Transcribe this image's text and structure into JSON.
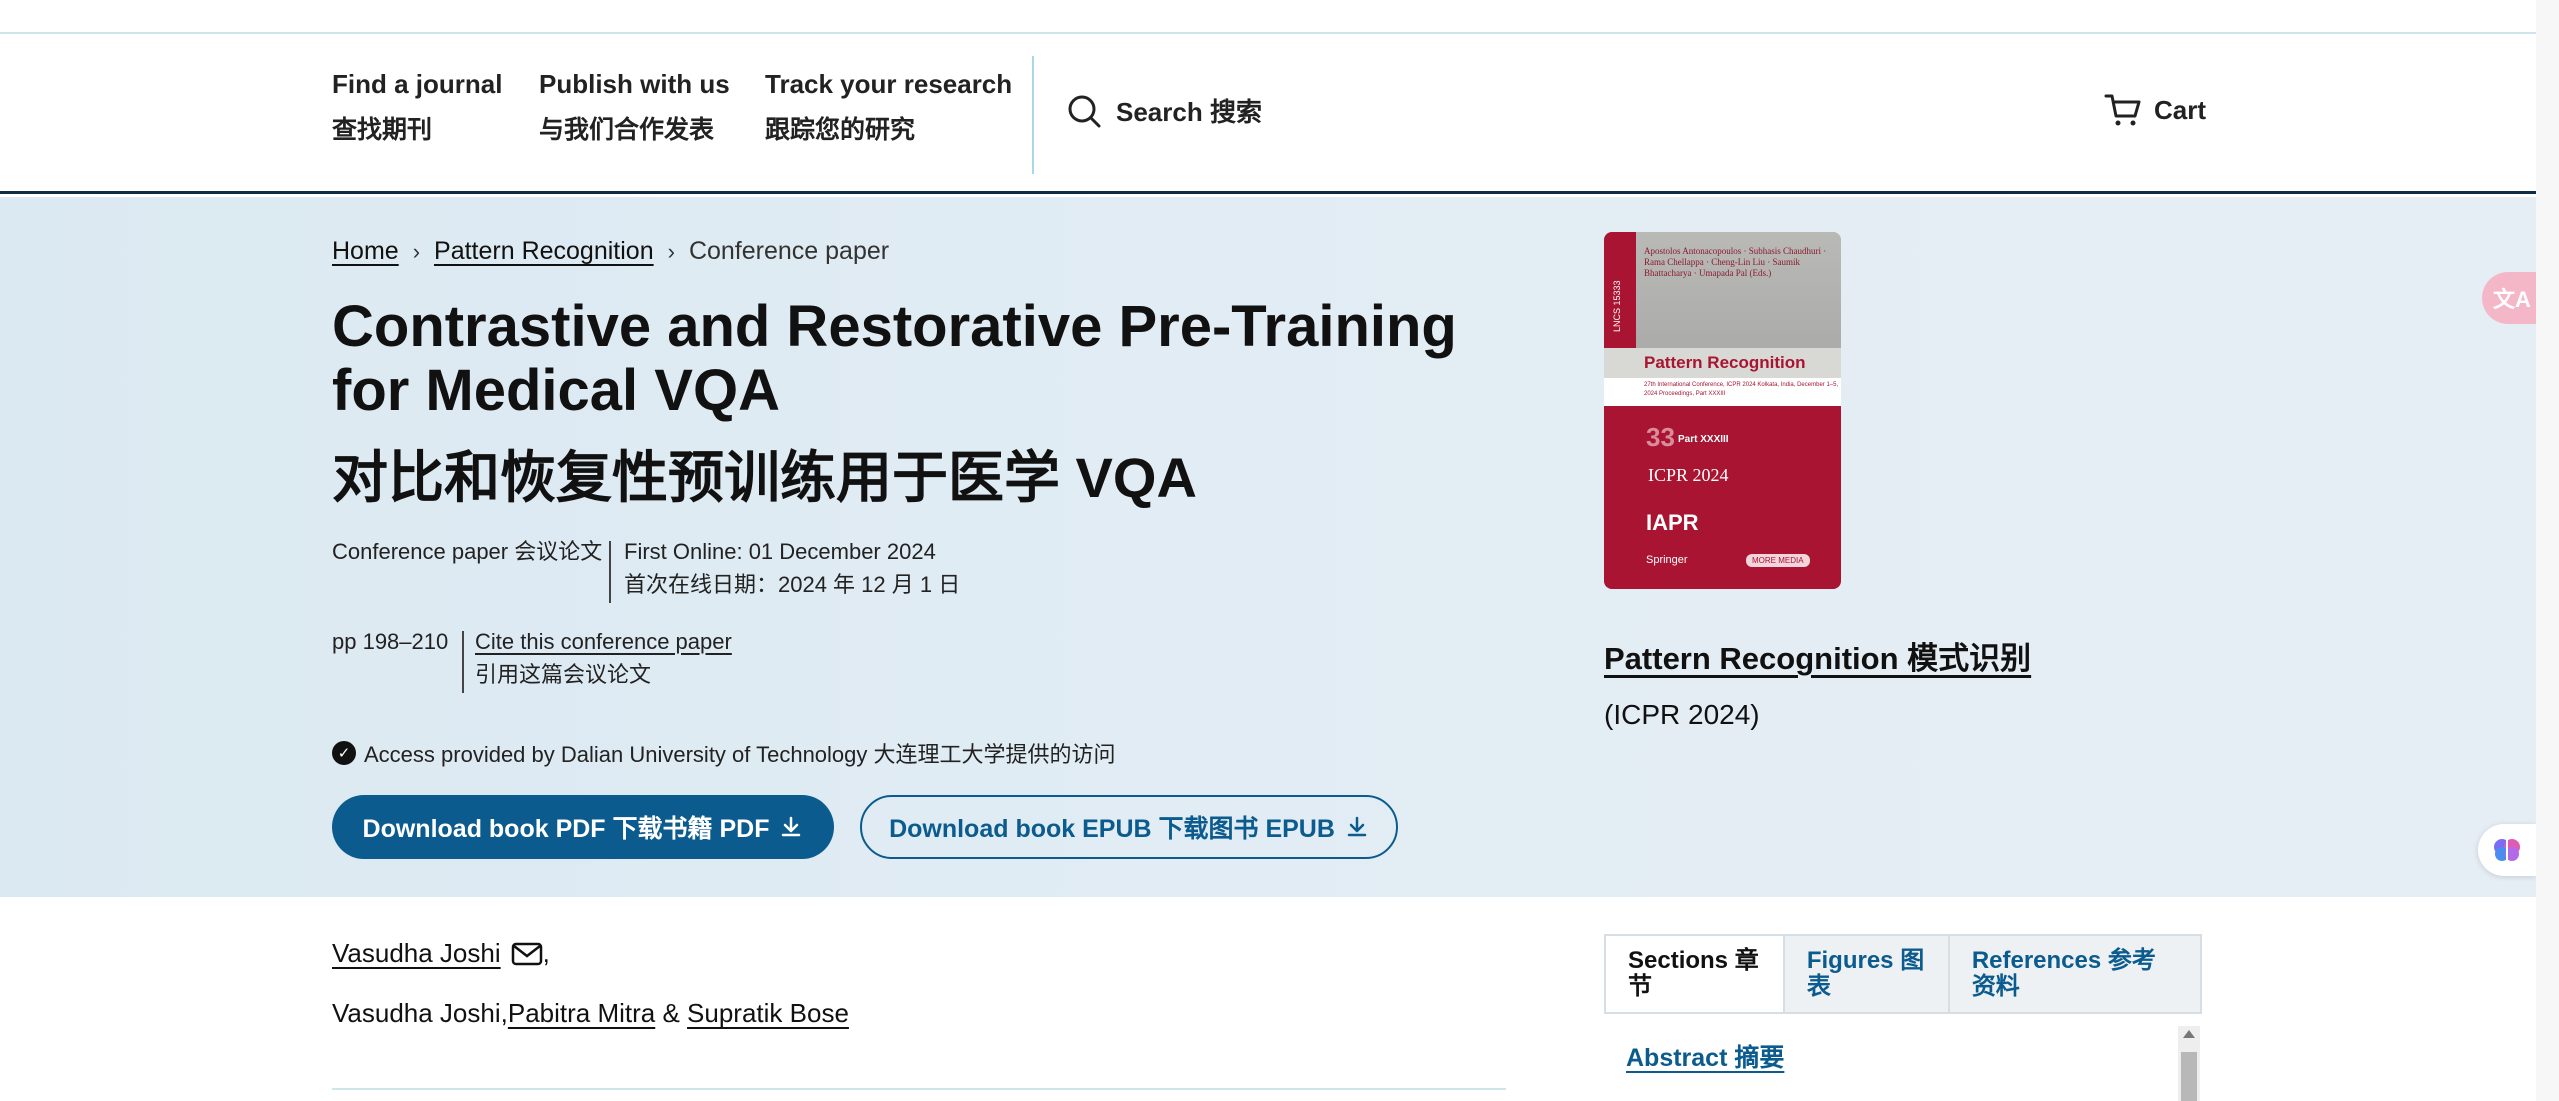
{
  "nav": {
    "items": [
      {
        "en": "Find a journal",
        "zh": "查找期刊"
      },
      {
        "en": "Publish with us",
        "zh": "与我们合作发表"
      },
      {
        "en": "Track your research",
        "zh": "跟踪您的研究"
      }
    ],
    "search_label": "Search 搜索",
    "cart_label": "Cart"
  },
  "breadcrumb": {
    "home": "Home",
    "parent": "Pattern Recognition",
    "current": "Conference paper"
  },
  "article": {
    "title": "Contrastive and Restorative Pre-Training for Medical VQA",
    "title_zh": "对比和恢复性预训练用于医学 VQA",
    "type": "Conference paper  会议论文",
    "first_online": "First Online: 01 December 2024",
    "first_online_zh": "首次在线日期：2024 年 12 月 1 日",
    "pages": "pp 198–210",
    "cite": "Cite this conference paper",
    "cite_zh": "引用这篇会议论文",
    "access": "Access provided by Dalian University of Technology  大连理工大学提供的访问",
    "download_pdf": "Download book PDF  下载书籍 PDF",
    "download_epub": "Download book EPUB  下载图书 EPUB"
  },
  "book": {
    "title": "Pattern Recognition  模式识别",
    "conference": "(ICPR 2024)",
    "cover": {
      "editors": "Apostolos Antonacopoulos · Subhasis Chaudhuri · Rama Chellappa · Cheng-Lin Liu · Saumik Bhattacharya · Umapada Pal (Eds.)",
      "series": "LNCS 15333",
      "title": "Pattern Recognition",
      "subtitle": "27th International Conference, ICPR 2024 Kolkata, India, December 1–5, 2024 Proceedings, Part XXXIII",
      "volume": "33",
      "part": "Part XXXIII",
      "icpr": "ICPR 2024",
      "iapr": "IAPR",
      "publisher": "Springer",
      "more": "MORE MEDIA"
    }
  },
  "authors": {
    "first": "Vasudha Joshi",
    "line2_prefix": "Vasudha Joshi,",
    "second": "Pabitra Mitra",
    "amp": " & ",
    "third": "Supratik Bose"
  },
  "tabs": [
    {
      "label": "Sections 章节"
    },
    {
      "label": "Figures 图表"
    },
    {
      "label": "References 参考资料"
    }
  ],
  "sections": {
    "abstract": "Abstract 摘要"
  },
  "floating": {
    "translate_glyph": "文A"
  },
  "colors": {
    "hero_bg": "#dde9f2",
    "primary": "#0b5b8f",
    "header_border": "#0e2d44",
    "cover_red": "#a81431"
  }
}
